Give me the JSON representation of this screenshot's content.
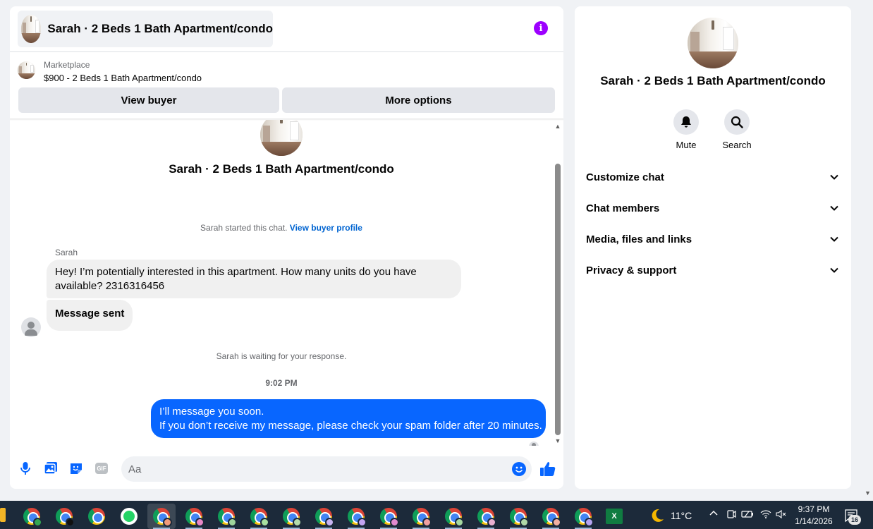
{
  "chat": {
    "title": "Sarah · 2 Beds 1 Bath Apartment/condo",
    "info_icon": "info-icon",
    "listing": {
      "category": "Marketplace",
      "price_title": "$900 - 2 Beds 1 Bath Apartment/condo"
    },
    "buttons": {
      "view_buyer": "View buyer",
      "more_options": "More options"
    },
    "conversation": {
      "title": "Sarah · 2 Beds 1 Bath Apartment/condo",
      "started_text": "Sarah started this chat.",
      "view_buyer_profile": "View buyer profile",
      "sender_name": "Sarah",
      "incoming_message_1": "Hey! I’m potentially interested in this apartment. How many units do you have available? 2316316456",
      "incoming_message_2": "Message sent",
      "waiting_text": "Sarah is waiting for your response.",
      "timestamp": "9:02 PM",
      "outgoing_line_1": "I’ll message you soon.",
      "outgoing_line_2": "If you don’t receive my message, please check your spam folder after 20 minutes."
    },
    "composer": {
      "placeholder": "Aa",
      "gif_label": "GIF"
    },
    "colors": {
      "accent_blue": "#0866ff",
      "info_purple": "#9d00ff",
      "link_blue": "#0064d1"
    }
  },
  "info_panel": {
    "title": "Sarah · 2 Beds 1 Bath Apartment/condo",
    "actions": [
      {
        "label": "Mute",
        "icon": "bell-icon"
      },
      {
        "label": "Search",
        "icon": "search-icon"
      }
    ],
    "sections": [
      {
        "label": "Customize chat"
      },
      {
        "label": "Chat members"
      },
      {
        "label": "Media, files and links"
      },
      {
        "label": "Privacy & support"
      }
    ]
  },
  "taskbar": {
    "weather_temp": "11°C",
    "time": "9:37 PM",
    "date": "1/14/2026",
    "notification_count": "16",
    "excel_label": "X"
  }
}
